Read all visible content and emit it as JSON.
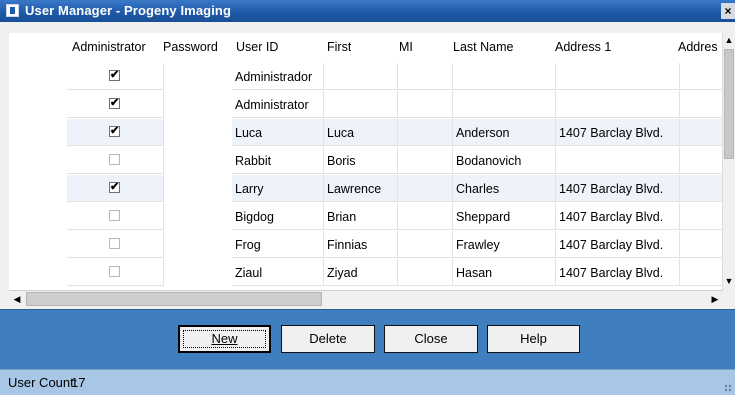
{
  "window": {
    "title": "User Manager - Progeny Imaging",
    "close_glyph": "×"
  },
  "columns": [
    "Administrator",
    "Password",
    "User ID",
    "First",
    "MI",
    "Last Name",
    "Address 1",
    "Addres"
  ],
  "rows": [
    {
      "admin": true,
      "user_id": "Administrador",
      "first": "",
      "mi": "",
      "last": "",
      "address1": ""
    },
    {
      "admin": true,
      "user_id": "Administrator",
      "first": "",
      "mi": "",
      "last": "",
      "address1": ""
    },
    {
      "admin": true,
      "user_id": "Luca",
      "first": "Luca",
      "mi": "",
      "last": "Anderson",
      "address1": "1407 Barclay Blvd."
    },
    {
      "admin": false,
      "user_id": "Rabbit",
      "first": "Boris",
      "mi": "",
      "last": "Bodanovich",
      "address1": ""
    },
    {
      "admin": true,
      "user_id": "Larry",
      "first": "Lawrence",
      "mi": "",
      "last": "Charles",
      "address1": "1407 Barclay Blvd."
    },
    {
      "admin": false,
      "user_id": "Bigdog",
      "first": "Brian",
      "mi": "",
      "last": "Sheppard",
      "address1": "1407 Barclay Blvd."
    },
    {
      "admin": false,
      "user_id": "Frog",
      "first": "Finnias",
      "mi": "",
      "last": "Frawley",
      "address1": "1407 Barclay Blvd."
    },
    {
      "admin": false,
      "user_id": "Ziaul",
      "first": "Ziyad",
      "mi": "",
      "last": "Hasan",
      "address1": "1407 Barclay Blvd."
    }
  ],
  "buttons": {
    "new": "New",
    "delete": "Delete",
    "close": "Close",
    "help": "Help"
  },
  "status": {
    "label": "User Count:",
    "count": "17"
  },
  "scrollbars": {
    "up": "▲",
    "down": "▼",
    "left": "◀",
    "right": "▶"
  },
  "colors": {
    "titlebar": "#1f5aa8",
    "buttonbar": "#3f7fc0",
    "statusbar": "#a8c6e5",
    "row_shade": "#eef2fa"
  },
  "check_glyph": "✔"
}
